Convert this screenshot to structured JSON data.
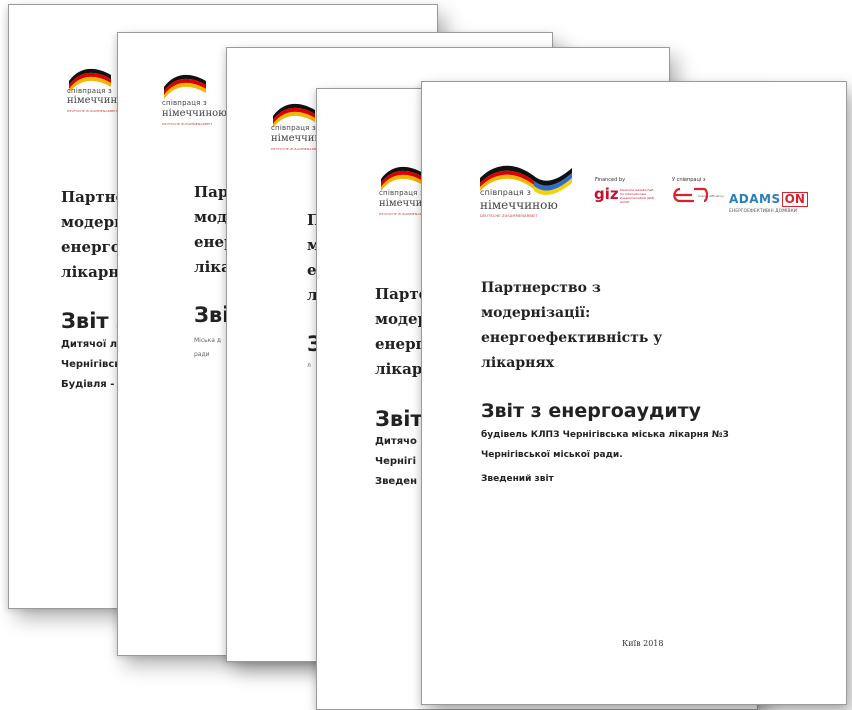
{
  "logo": {
    "line1": "співпраця з",
    "line2": "німеччиною",
    "line3": "DEUTSCHE ZUSAMMENARBEIT"
  },
  "partners": {
    "label_financed": "Financed by",
    "label_implemented": "Implemented by",
    "label_in_cooperation": "У співпраці з",
    "giz": "giz",
    "giz_note": "Deutsche Gesellschaft für Internationale Zusammenarbeit (GIZ) GmbH",
    "eu_note": "energy efficiency",
    "adamson_main": "ADAMS",
    "adamson_on": "ON",
    "adamson_sub": "ЕНЕРГОЕФЕКТИВНІ ДОМІВКИ"
  },
  "front_page": {
    "title_lines": [
      "Партнерство з",
      "модернізації:",
      "енергоефективність у",
      "лікарнях"
    ],
    "heading": "Звіт з енергоаудиту",
    "sub_lines": [
      "будівель КЛПЗ Чернігівська міська лікарня №3",
      "Чернігівської міської ради.",
      "Зведений звіт"
    ],
    "footer": "Київ 2018"
  },
  "back_page_1": {
    "title_lines": [
      "Партне",
      "модерн",
      "енерго",
      "лікарн"
    ],
    "heading": "Звіт з",
    "sub_lines": [
      "Дитячої л",
      "Чернігівсь",
      "Будівля -"
    ]
  },
  "back_page_2": {
    "title_lines": [
      "Парт",
      "моде",
      "енер",
      "лікар"
    ],
    "heading": "Звіт",
    "sub_lines": [
      "Міська д",
      "ради"
    ]
  },
  "back_page_3": {
    "title_lines": [
      "П",
      "м",
      "е",
      "л"
    ],
    "heading": "З",
    "sub_lines": [
      "л"
    ]
  },
  "back_page_4": {
    "title_lines": [
      "Парте",
      "модер",
      "енерг",
      "лікарн"
    ],
    "heading": "Звіт",
    "sub_lines": [
      "Дитячо",
      "Чернігі",
      "Зведен"
    ]
  }
}
